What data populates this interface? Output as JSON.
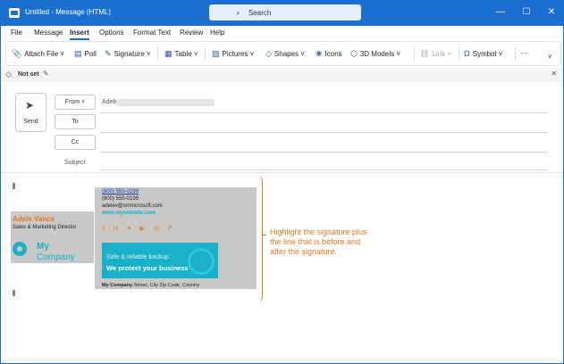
{
  "window": {
    "title": "Untitled  -  Message (HTML)",
    "search_placeholder": "Search",
    "controls": {
      "minimize": "—",
      "maximize": "☐",
      "close": "✕"
    }
  },
  "menu": {
    "items": [
      "File",
      "Message",
      "Insert",
      "Options",
      "Format Text",
      "Review",
      "Help"
    ],
    "active": "Insert"
  },
  "ribbon": {
    "attach_file": "Attach File",
    "poll": "Poll",
    "signature": "Signature",
    "table": "Table",
    "pictures": "Pictures",
    "shapes": "Shapes",
    "icons": "Icons",
    "models_3d": "3D Models",
    "link": "Link",
    "symbol": "Symbol",
    "more": "···"
  },
  "infobar": {
    "label": "Not set",
    "close": "✕"
  },
  "compose": {
    "send": "Send",
    "from_label": "From",
    "from_value": "AdeleV",
    "to_label": "To",
    "cc_label": "Cc",
    "subject_label": "Subject"
  },
  "signature": {
    "name": "Adele Vance",
    "title": "Sales & Marketing Director",
    "logo_line1": "My",
    "logo_line2": "Company",
    "phone1": "(800) 555-0299",
    "phone2": "(800) 555-0199",
    "email": "adelev@onmicrosoft.com",
    "website": "www.mywebsite.com",
    "social_icons": [
      "facebook-icon",
      "linkedin-icon",
      "twitter-icon",
      "youtube-icon",
      "instagram-icon",
      "pinterest-icon"
    ],
    "banner_line1": "Safe & reliable backup",
    "banner_line2": "We protect your business",
    "footer_company": "My Company",
    "footer_address": "Street, City Zip Code, Country"
  },
  "annotation": {
    "line1": "Highlight the signature plus",
    "line2": "the line that is before and",
    "line3": "after the signature."
  },
  "colors": {
    "titlebar": "#1a6fd0",
    "highlight": "#c8c8c8",
    "accent_orange": "#e8781f",
    "accent_teal": "#1ab0c8"
  }
}
